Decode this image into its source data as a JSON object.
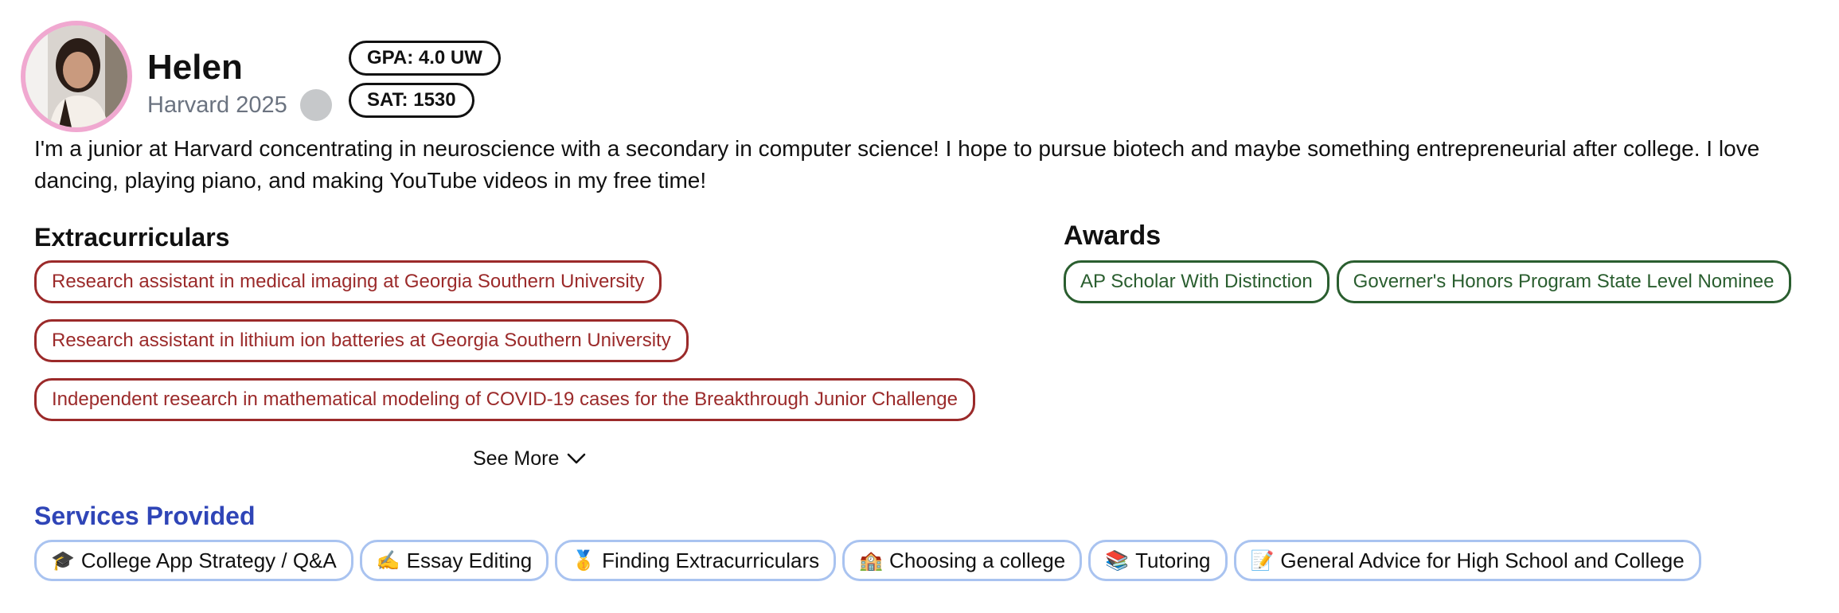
{
  "profile": {
    "name": "Helen",
    "school": "Harvard 2025",
    "gpa": "GPA: 4.0 UW",
    "sat": "SAT: 1530",
    "bio": "I'm a junior at Harvard concentrating in neuroscience with a secondary in computer science! I hope to pursue biotech and maybe something entrepreneurial after college. I love dancing, playing piano, and making YouTube videos in my free time!",
    "avatar_border_color": "#f0a8d0"
  },
  "extracurriculars": {
    "title": "Extracurriculars",
    "items": [
      "Research assistant in medical imaging at Georgia Southern University",
      "Research assistant in lithium ion batteries at Georgia Southern University",
      "Independent research in mathematical modeling of COVID-19 cases for the Breakthrough Junior Challenge"
    ],
    "color": "#9b2a2a"
  },
  "awards": {
    "title": "Awards",
    "items": [
      "AP Scholar With Distinction",
      "Governer's Honors Program State Level Nominee"
    ],
    "color": "#2a5e2f"
  },
  "see_more": {
    "label": "See More",
    "icon": "chevron-down-icon"
  },
  "services": {
    "title": "Services Provided",
    "title_color": "#2f45b7",
    "items": [
      {
        "icon": "🎓",
        "label": "College App Strategy / Q&A"
      },
      {
        "icon": "✍️",
        "label": "Essay Editing"
      },
      {
        "icon": "🥇",
        "label": "Finding Extracurriculars"
      },
      {
        "icon": "🏫",
        "label": "Choosing a college"
      },
      {
        "icon": "📚",
        "label": "Tutoring"
      },
      {
        "icon": "📝",
        "label": "General Advice for High School and College"
      }
    ]
  }
}
